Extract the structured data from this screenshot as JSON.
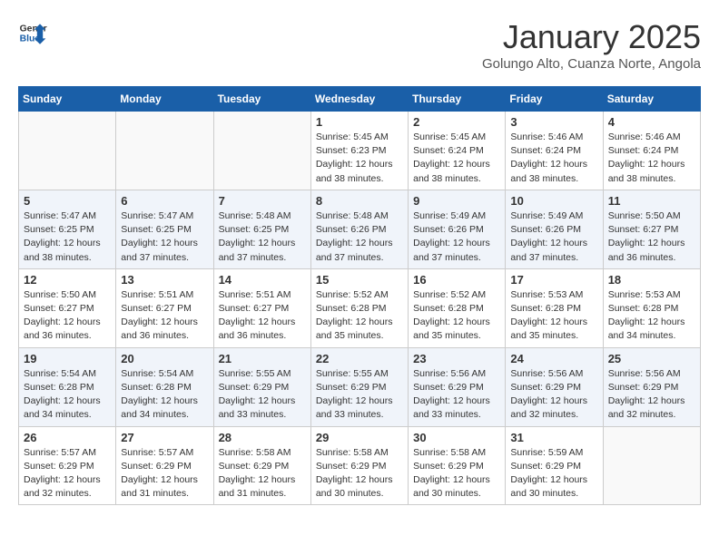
{
  "header": {
    "logo_line1": "General",
    "logo_line2": "Blue",
    "month": "January 2025",
    "location": "Golungo Alto, Cuanza Norte, Angola"
  },
  "weekdays": [
    "Sunday",
    "Monday",
    "Tuesday",
    "Wednesday",
    "Thursday",
    "Friday",
    "Saturday"
  ],
  "weeks": [
    {
      "alt": false,
      "days": [
        {
          "num": "",
          "info": ""
        },
        {
          "num": "",
          "info": ""
        },
        {
          "num": "",
          "info": ""
        },
        {
          "num": "1",
          "info": "Sunrise: 5:45 AM\nSunset: 6:23 PM\nDaylight: 12 hours\nand 38 minutes."
        },
        {
          "num": "2",
          "info": "Sunrise: 5:45 AM\nSunset: 6:24 PM\nDaylight: 12 hours\nand 38 minutes."
        },
        {
          "num": "3",
          "info": "Sunrise: 5:46 AM\nSunset: 6:24 PM\nDaylight: 12 hours\nand 38 minutes."
        },
        {
          "num": "4",
          "info": "Sunrise: 5:46 AM\nSunset: 6:24 PM\nDaylight: 12 hours\nand 38 minutes."
        }
      ]
    },
    {
      "alt": true,
      "days": [
        {
          "num": "5",
          "info": "Sunrise: 5:47 AM\nSunset: 6:25 PM\nDaylight: 12 hours\nand 38 minutes."
        },
        {
          "num": "6",
          "info": "Sunrise: 5:47 AM\nSunset: 6:25 PM\nDaylight: 12 hours\nand 37 minutes."
        },
        {
          "num": "7",
          "info": "Sunrise: 5:48 AM\nSunset: 6:25 PM\nDaylight: 12 hours\nand 37 minutes."
        },
        {
          "num": "8",
          "info": "Sunrise: 5:48 AM\nSunset: 6:26 PM\nDaylight: 12 hours\nand 37 minutes."
        },
        {
          "num": "9",
          "info": "Sunrise: 5:49 AM\nSunset: 6:26 PM\nDaylight: 12 hours\nand 37 minutes."
        },
        {
          "num": "10",
          "info": "Sunrise: 5:49 AM\nSunset: 6:26 PM\nDaylight: 12 hours\nand 37 minutes."
        },
        {
          "num": "11",
          "info": "Sunrise: 5:50 AM\nSunset: 6:27 PM\nDaylight: 12 hours\nand 36 minutes."
        }
      ]
    },
    {
      "alt": false,
      "days": [
        {
          "num": "12",
          "info": "Sunrise: 5:50 AM\nSunset: 6:27 PM\nDaylight: 12 hours\nand 36 minutes."
        },
        {
          "num": "13",
          "info": "Sunrise: 5:51 AM\nSunset: 6:27 PM\nDaylight: 12 hours\nand 36 minutes."
        },
        {
          "num": "14",
          "info": "Sunrise: 5:51 AM\nSunset: 6:27 PM\nDaylight: 12 hours\nand 36 minutes."
        },
        {
          "num": "15",
          "info": "Sunrise: 5:52 AM\nSunset: 6:28 PM\nDaylight: 12 hours\nand 35 minutes."
        },
        {
          "num": "16",
          "info": "Sunrise: 5:52 AM\nSunset: 6:28 PM\nDaylight: 12 hours\nand 35 minutes."
        },
        {
          "num": "17",
          "info": "Sunrise: 5:53 AM\nSunset: 6:28 PM\nDaylight: 12 hours\nand 35 minutes."
        },
        {
          "num": "18",
          "info": "Sunrise: 5:53 AM\nSunset: 6:28 PM\nDaylight: 12 hours\nand 34 minutes."
        }
      ]
    },
    {
      "alt": true,
      "days": [
        {
          "num": "19",
          "info": "Sunrise: 5:54 AM\nSunset: 6:28 PM\nDaylight: 12 hours\nand 34 minutes."
        },
        {
          "num": "20",
          "info": "Sunrise: 5:54 AM\nSunset: 6:28 PM\nDaylight: 12 hours\nand 34 minutes."
        },
        {
          "num": "21",
          "info": "Sunrise: 5:55 AM\nSunset: 6:29 PM\nDaylight: 12 hours\nand 33 minutes."
        },
        {
          "num": "22",
          "info": "Sunrise: 5:55 AM\nSunset: 6:29 PM\nDaylight: 12 hours\nand 33 minutes."
        },
        {
          "num": "23",
          "info": "Sunrise: 5:56 AM\nSunset: 6:29 PM\nDaylight: 12 hours\nand 33 minutes."
        },
        {
          "num": "24",
          "info": "Sunrise: 5:56 AM\nSunset: 6:29 PM\nDaylight: 12 hours\nand 32 minutes."
        },
        {
          "num": "25",
          "info": "Sunrise: 5:56 AM\nSunset: 6:29 PM\nDaylight: 12 hours\nand 32 minutes."
        }
      ]
    },
    {
      "alt": false,
      "days": [
        {
          "num": "26",
          "info": "Sunrise: 5:57 AM\nSunset: 6:29 PM\nDaylight: 12 hours\nand 32 minutes."
        },
        {
          "num": "27",
          "info": "Sunrise: 5:57 AM\nSunset: 6:29 PM\nDaylight: 12 hours\nand 31 minutes."
        },
        {
          "num": "28",
          "info": "Sunrise: 5:58 AM\nSunset: 6:29 PM\nDaylight: 12 hours\nand 31 minutes."
        },
        {
          "num": "29",
          "info": "Sunrise: 5:58 AM\nSunset: 6:29 PM\nDaylight: 12 hours\nand 30 minutes."
        },
        {
          "num": "30",
          "info": "Sunrise: 5:58 AM\nSunset: 6:29 PM\nDaylight: 12 hours\nand 30 minutes."
        },
        {
          "num": "31",
          "info": "Sunrise: 5:59 AM\nSunset: 6:29 PM\nDaylight: 12 hours\nand 30 minutes."
        },
        {
          "num": "",
          "info": ""
        }
      ]
    }
  ]
}
